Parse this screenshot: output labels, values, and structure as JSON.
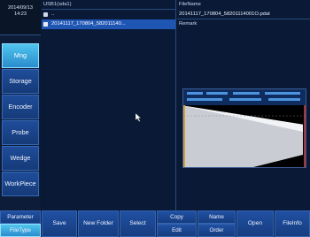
{
  "datetime": {
    "date": "2014/09/13",
    "time": "14:23"
  },
  "sidebar": {
    "items": [
      {
        "label": "Mng",
        "active": true
      },
      {
        "label": "Storage",
        "active": false
      },
      {
        "label": "Encoder",
        "active": false
      },
      {
        "label": "Probe",
        "active": false
      },
      {
        "label": "Wedge",
        "active": false
      },
      {
        "label": "WorkPiece",
        "active": false
      }
    ]
  },
  "file_browser": {
    "path": "USB1(sda1)",
    "rows": [
      {
        "name": "..",
        "icon": "folder-icon"
      },
      {
        "name": "20141117_170804_582011140...",
        "icon": "document-icon",
        "selected": true
      }
    ]
  },
  "info": {
    "filename_label": "FileName",
    "filename_value": "20141117_170804_58201114001O.pdat",
    "remark_label": "Remark"
  },
  "toolbar": {
    "parameter": "Parameter",
    "filetype": "FileType",
    "save": "Save",
    "new_folder": "New Folder",
    "select": "Select",
    "copy": "Copy",
    "edit": "Edit",
    "name": "Name",
    "order": "Order",
    "open": "Open",
    "fileinfo": "FileInfo"
  },
  "colors": {
    "accent": "#2b8ccd",
    "button": "#1f4d9a",
    "background": "#0a1830"
  }
}
